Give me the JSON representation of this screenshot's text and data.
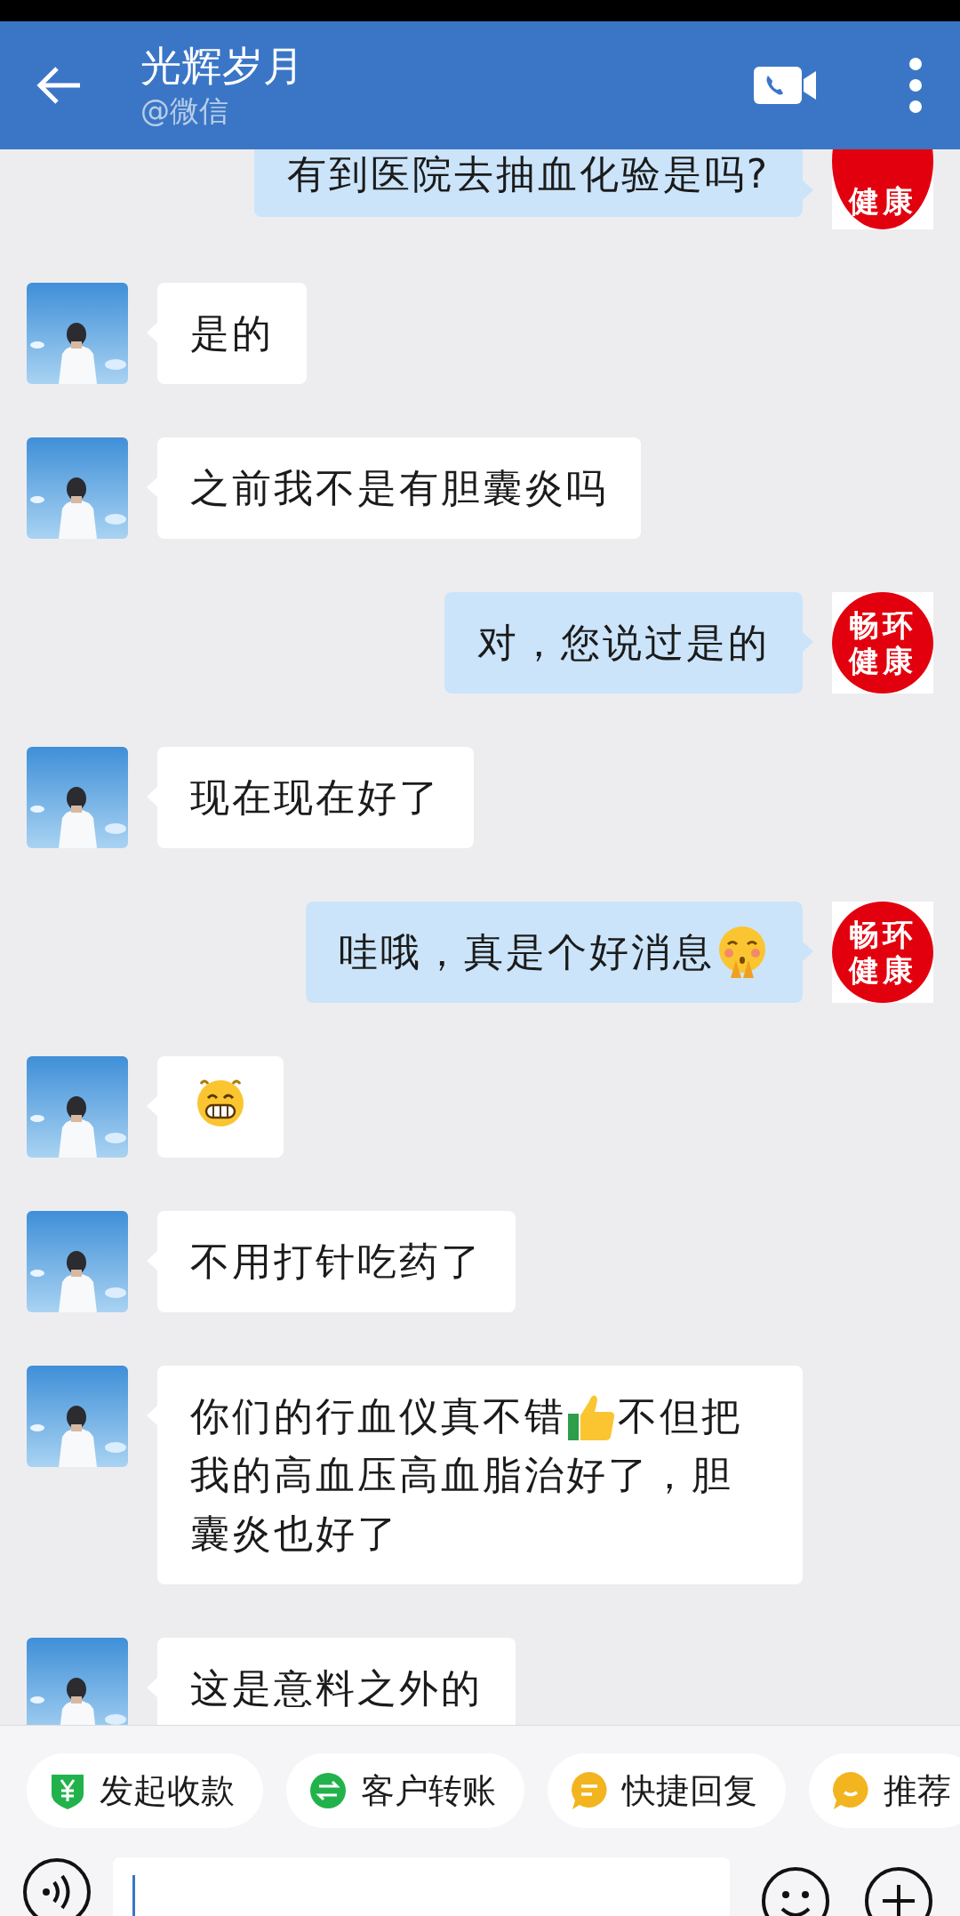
{
  "header": {
    "title": "光辉岁月",
    "subtitle": "@微信"
  },
  "messages": [
    {
      "kind": "sent",
      "parts": [
        {
          "kind": "text",
          "text": "有到医院去抽血化验是吗?"
        }
      ],
      "logo": [
        "健康"
      ]
    },
    {
      "kind": "received",
      "parts": [
        {
          "kind": "text",
          "text": "是的"
        }
      ]
    },
    {
      "kind": "received",
      "parts": [
        {
          "kind": "text",
          "text": "之前我不是有胆囊炎吗"
        }
      ]
    },
    {
      "kind": "sent",
      "parts": [
        {
          "kind": "text",
          "text": "对，您说过是的"
        }
      ],
      "logo": [
        "畅环",
        "健康"
      ]
    },
    {
      "kind": "received",
      "parts": [
        {
          "kind": "text",
          "text": "现在现在好了"
        }
      ]
    },
    {
      "kind": "sent",
      "parts": [
        {
          "kind": "text",
          "text": "哇哦，真是个好消息"
        },
        {
          "kind": "shy"
        }
      ],
      "logo": [
        "畅环",
        "健康"
      ]
    },
    {
      "kind": "received",
      "parts": [
        {
          "kind": "grin"
        }
      ]
    },
    {
      "kind": "received",
      "parts": [
        {
          "kind": "text",
          "text": "不用打针吃药了"
        }
      ]
    },
    {
      "kind": "received",
      "parts": [
        {
          "kind": "text",
          "text": "你们的行血仪真不错"
        },
        {
          "kind": "thumbsup"
        },
        {
          "kind": "text",
          "text": "不但把我的高血压高血脂治好了，胆囊炎也好了"
        }
      ]
    },
    {
      "kind": "received",
      "parts": [
        {
          "kind": "text",
          "text": "这是意料之外的"
        }
      ]
    }
  ],
  "quick_actions": [
    {
      "kind": "shield",
      "label": "发起收款"
    },
    {
      "kind": "arrows",
      "label": "客户转账"
    },
    {
      "kind": "note",
      "label": "快捷回复"
    },
    {
      "kind": "smile",
      "label": "推荐"
    }
  ]
}
